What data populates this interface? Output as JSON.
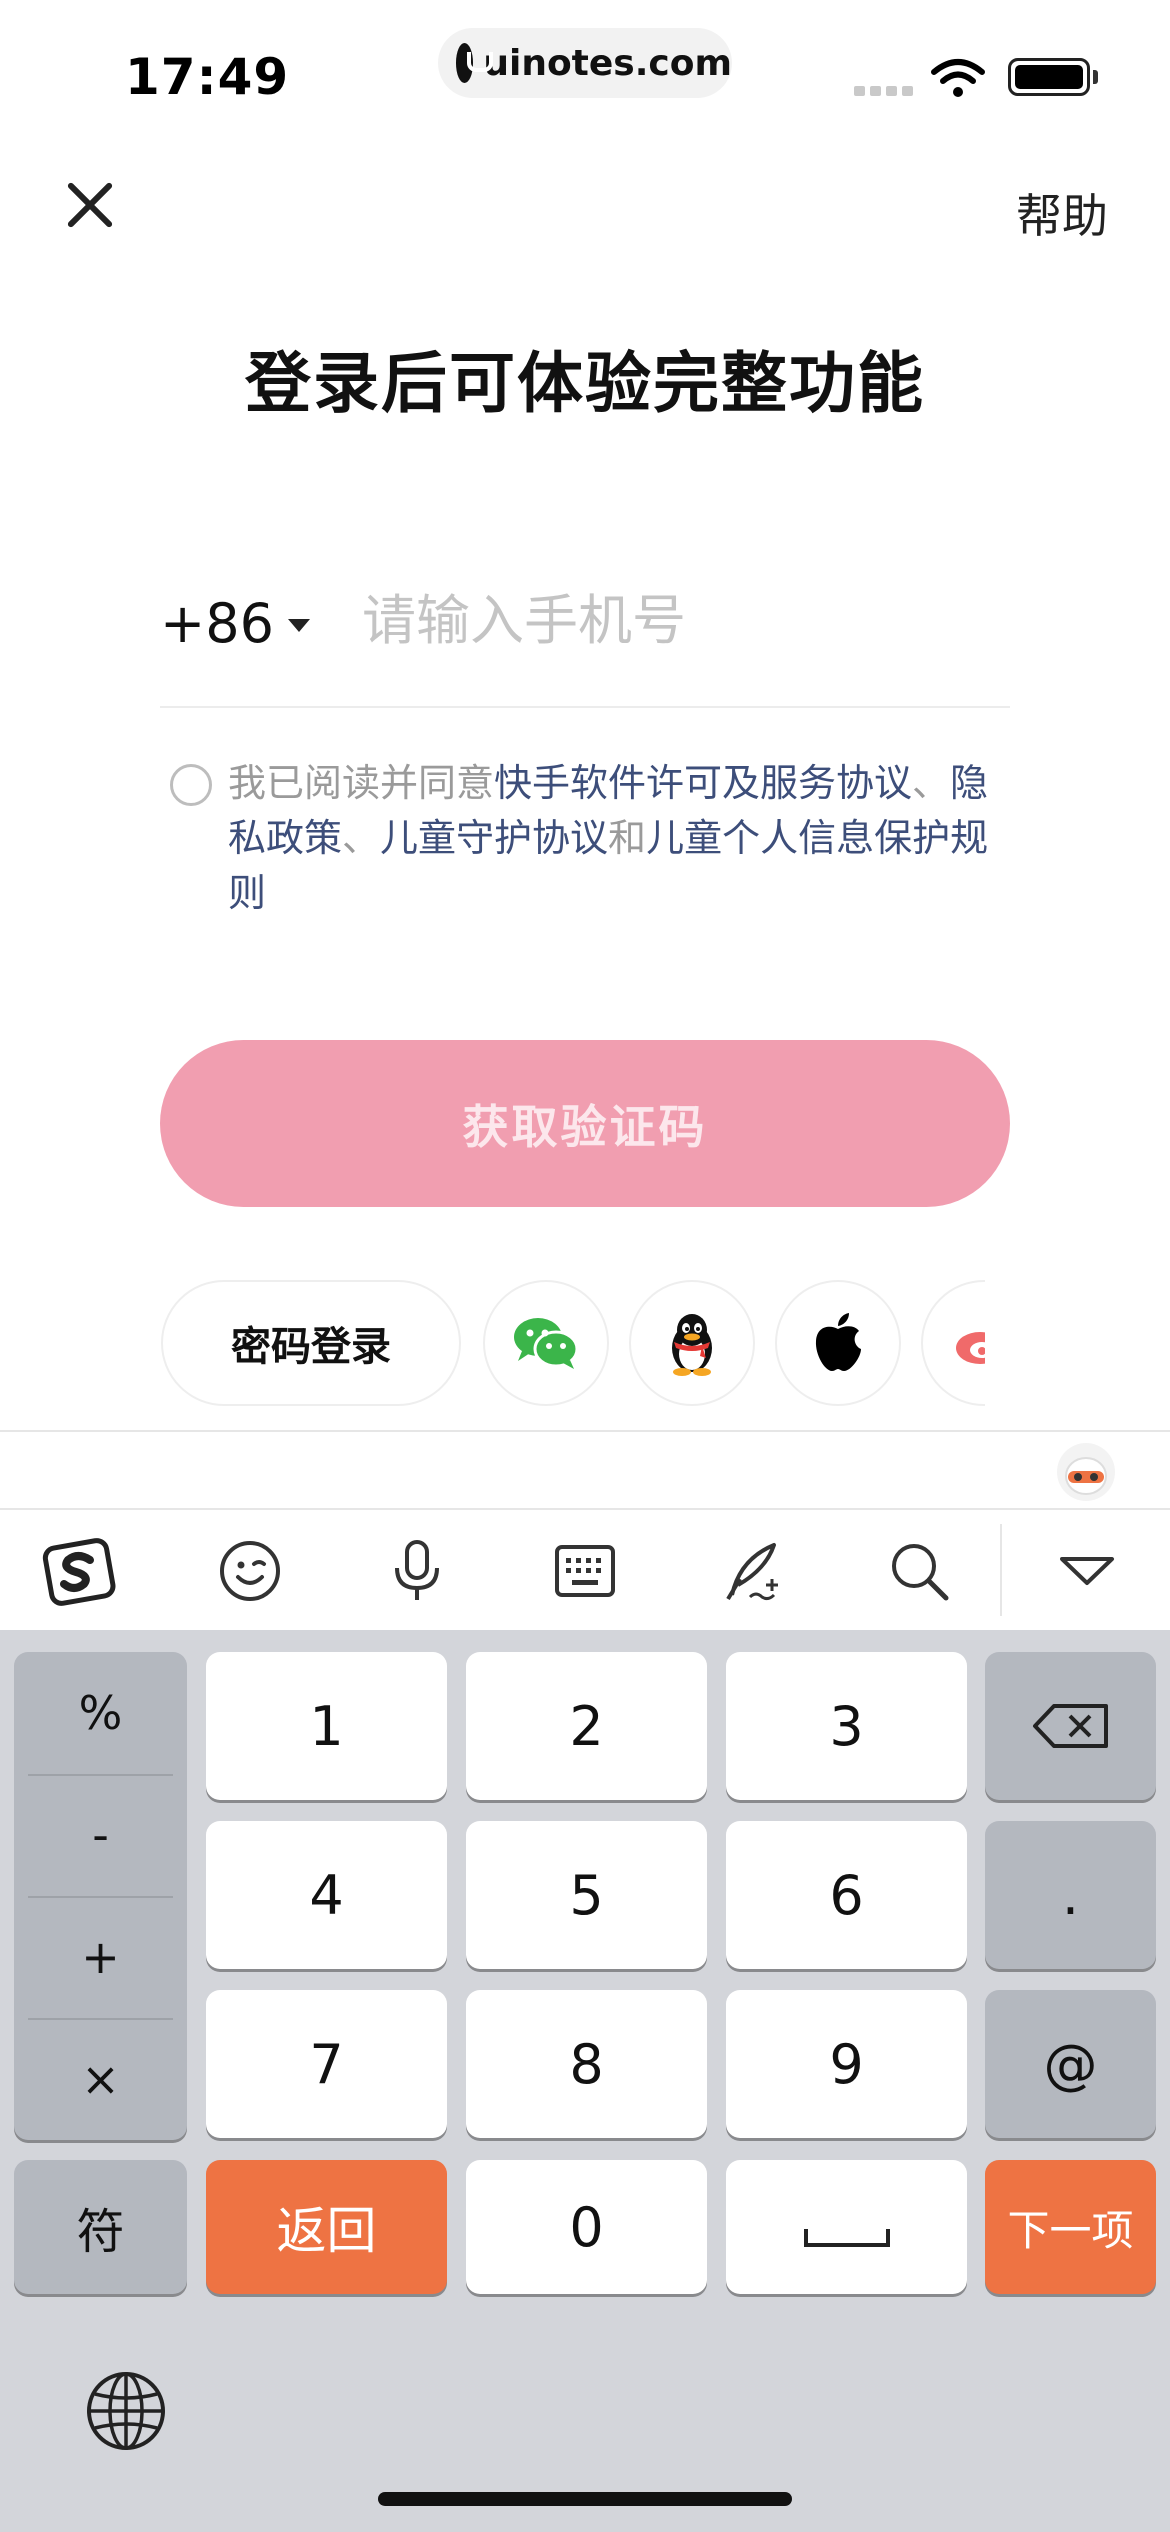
{
  "status_bar": {
    "time": "17:49",
    "url": "uinotes.com"
  },
  "header": {
    "help_label": "帮助",
    "title": "登录后可体验完整功能"
  },
  "phone": {
    "country_code": "+86",
    "placeholder": "请输入手机号"
  },
  "agreement": {
    "prefix": "我已阅读并同意",
    "link1": "快手软件许可及服务协议",
    "sep1": "、",
    "link2": "隐私政策",
    "sep2": "、",
    "link3": "儿童守护协议",
    "and": "和",
    "link4": "儿童个人信息保护规则"
  },
  "get_code_button": "获取验证码",
  "alt_login": {
    "password_label": "密码登录",
    "socials": [
      "wechat-icon",
      "qq-icon",
      "apple-icon",
      "weibo-icon"
    ]
  },
  "keyboard": {
    "symbols": [
      "%",
      "-",
      "+",
      "×"
    ],
    "digits": [
      "1",
      "2",
      "3",
      "4",
      "5",
      "6",
      "7",
      "8",
      "9",
      "0"
    ],
    "dot": ".",
    "at": "@",
    "fu": "符",
    "back": "返回",
    "next": "下一项"
  },
  "colors": {
    "primary_button": "#f19eb0",
    "link": "#3d4e7a",
    "keyboard_accent": "#ee7343"
  }
}
